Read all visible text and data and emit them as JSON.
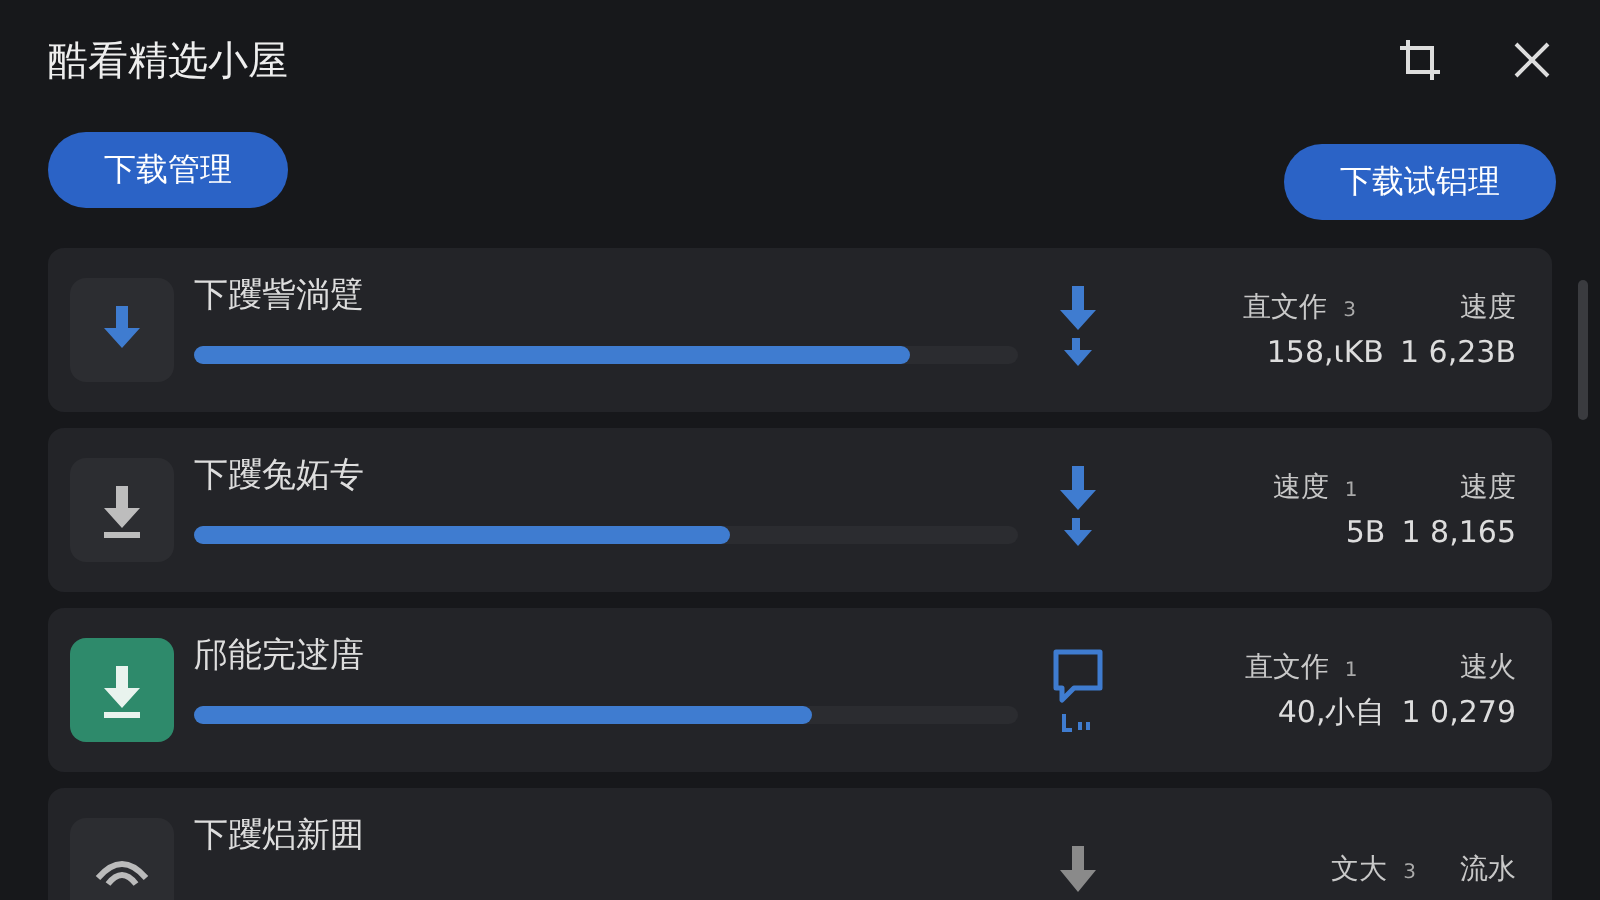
{
  "window": {
    "title": "酷看精选小屋"
  },
  "buttons": [
    {
      "label": "下载管理"
    },
    {
      "label": "下载试铝理"
    }
  ],
  "downloads": [
    {
      "name": "下躩訾淌躄",
      "kind": "active",
      "level": 0.87,
      "action": {
        "kind": "download"
      },
      "label_1": "直文作",
      "count": "3",
      "label_2": "速度",
      "value_1": "158,ιKB",
      "value_2": "1 6,23B"
    },
    {
      "name": "下躩兔妬专",
      "kind": "paused",
      "level": 0.65,
      "action": {
        "kind": "download"
      },
      "label_1": "速度",
      "count": "1",
      "label_2": "速度",
      "value_1": "5B",
      "value_2": "1 8,165"
    },
    {
      "name": "邤能完逑庴",
      "kind": "done",
      "level": 0.75,
      "action": {
        "kind": "comment"
      },
      "label_1": "直文作",
      "count": "1",
      "label_2": "速火",
      "value_1": "40,小自",
      "value_2": "1 0,279"
    },
    {
      "name": "下躩焒新囲",
      "kind": "queued",
      "action": {
        "kind": "waiting"
      },
      "label_1": "文大",
      "count": "3",
      "label_2": "流水"
    }
  ]
}
